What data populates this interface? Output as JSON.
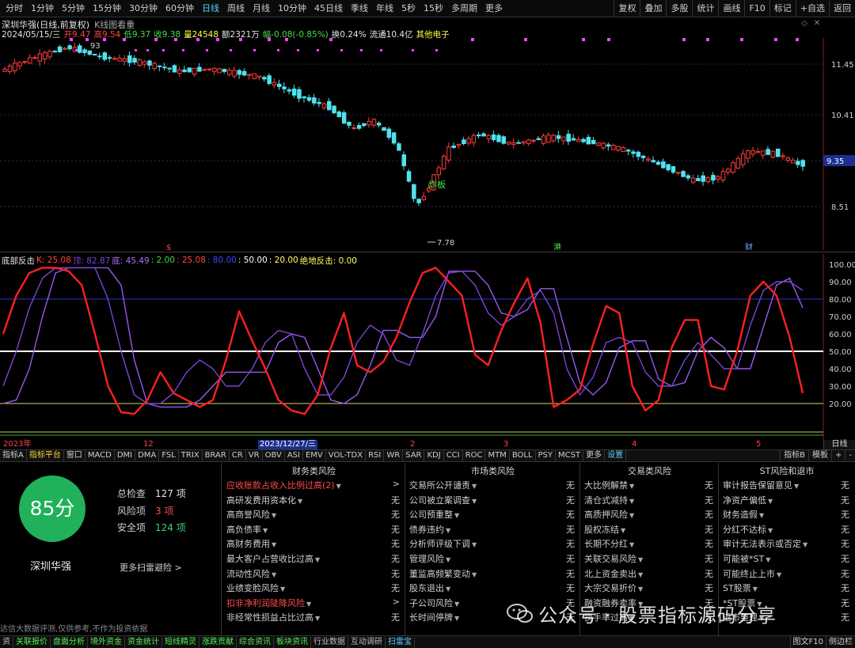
{
  "toolbar": {
    "periods": [
      "分时",
      "1分钟",
      "5分钟",
      "15分钟",
      "30分钟",
      "60分钟",
      "日线",
      "周线",
      "月线",
      "10分钟",
      "45日线",
      "季线",
      "年线",
      "5秒",
      "15秒",
      "多周期",
      "更多"
    ],
    "active_period": "日线",
    "tools": [
      "复权",
      "叠加",
      "多股",
      "统计",
      "画线",
      "F10",
      "标记",
      "+自选",
      "返回"
    ]
  },
  "stock_info": {
    "title": "深圳华强(日线,前复权)",
    "view_label": "K线图看重",
    "date": "2024/05/15/三",
    "open": "开9.47",
    "high": "高9.54",
    "low": "低9.37",
    "close": "收9.38",
    "volume": "量24548",
    "amount": "额2321万",
    "change": "幅-0.08(-0.85%)",
    "turnover": "换0.24%",
    "float_cap": "流通10.4亿",
    "sector": "其他电子"
  },
  "kline_chart": {
    "price_ticks": [
      "11.45",
      "10.41",
      "9.35",
      "8.51"
    ],
    "current_price": "9.35",
    "high_label": "93",
    "low_label": "7.78",
    "signal_label": "炸板",
    "markers": [
      "$",
      "港",
      "财"
    ]
  },
  "oscillator": {
    "header": {
      "name": "底部反击",
      "k": "K: 25.08",
      "d": "顶: 82.87",
      "j": "底: 45.49",
      "v1": ": 2.00",
      "v2": ": 25.08",
      "v3": ": 80.00",
      "v4": ": 50.00",
      "v5": ": 20.00",
      "v6": "绝地反击: 0.00"
    },
    "y_ticks": [
      "100.00",
      "90.00",
      "80.00",
      "70.00",
      "60.00",
      "50.00",
      "40.00",
      "30.00",
      "20.00"
    ]
  },
  "chart_data": [
    {
      "type": "line",
      "title": "",
      "series": [
        {
          "values": [
            60,
            82,
            95,
            98,
            98,
            96,
            88,
            60,
            30,
            15,
            14,
            22,
            38,
            26,
            22,
            18,
            22,
            45,
            73,
            56,
            40,
            22,
            16,
            14,
            25,
            52,
            72,
            42,
            38,
            44,
            58,
            78,
            95,
            98,
            90,
            82,
            48,
            42,
            62,
            78,
            92,
            66,
            18,
            22,
            28,
            54,
            76,
            72,
            30,
            16,
            22,
            52,
            68,
            68,
            30,
            28,
            50,
            82,
            90,
            82,
            58,
            26
          ]
        },
        {
          "values": [
            30,
            50,
            75,
            92,
            98,
            98,
            98,
            98,
            80,
            50,
            25,
            20,
            20,
            26,
            38,
            45,
            40,
            30,
            30,
            40,
            55,
            62,
            60,
            40,
            25,
            25,
            35,
            55,
            65,
            60,
            45,
            42,
            60,
            82,
            95,
            96,
            88,
            72,
            65,
            70,
            80,
            85,
            72,
            40,
            25,
            35,
            55,
            58,
            55,
            38,
            30,
            30,
            45,
            55,
            48,
            40,
            40,
            65,
            85,
            90,
            90,
            85
          ]
        },
        {
          "values": [
            20,
            22,
            40,
            70,
            95,
            98,
            98,
            98,
            98,
            88,
            45,
            20,
            18,
            18,
            18,
            22,
            30,
            38,
            38,
            38,
            38,
            55,
            60,
            58,
            40,
            22,
            20,
            25,
            42,
            62,
            62,
            58,
            58,
            70,
            96,
            96,
            96,
            88,
            72,
            70,
            74,
            86,
            86,
            58,
            32,
            25,
            32,
            52,
            56,
            56,
            34,
            30,
            32,
            50,
            58,
            52,
            40,
            40,
            64,
            88,
            92,
            75
          ]
        }
      ],
      "y_ticks": [
        "100.00",
        "90.00",
        "80.00",
        "70.00",
        "60.00",
        "50.00",
        "40.00",
        "30.00",
        "20.00"
      ],
      "ylim": [
        10,
        100
      ],
      "reference_lines": [
        80,
        50,
        20
      ]
    }
  ],
  "date_axis": {
    "labels": [
      "2023年",
      "12",
      "2023/12/27/三",
      "2",
      "3",
      "4",
      "5"
    ],
    "right_button": "日线"
  },
  "indicators": {
    "tabs": [
      "指标A",
      "指标平台",
      "窗口",
      "MACD",
      "DMI",
      "DMA",
      "FSL",
      "TRIX",
      "BRAR",
      "CR",
      "VR",
      "OBV",
      "ASI",
      "EMV",
      "VOL-TDX",
      "RSI",
      "WR",
      "SAR",
      "KDJ",
      "CCI",
      "ROC",
      "MTM",
      "BOLL",
      "PSY",
      "MCST",
      "更多",
      "设置"
    ],
    "active": "指标平台",
    "right": [
      "指标B",
      "模板",
      "+",
      "-"
    ]
  },
  "scan": {
    "score": "85分",
    "total_label": "总检查",
    "total_value": "127 项",
    "risk_label": "风险项",
    "risk_value": "3 项",
    "safe_label": "安全项",
    "safe_value": "124 项",
    "stock_name": "深圳华强",
    "more_link": "更多扫雷避险 >",
    "disclaimer": "达信大数据评测,仅供参考,不作为投资依据",
    "columns": [
      {
        "title": "财务类风险",
        "rows": [
          {
            "label": "应收账款占收入比例过高(2)",
            "value": ">",
            "warn": true
          },
          {
            "label": "高研发费用资本化",
            "value": "无",
            "warn": false
          },
          {
            "label": "高商誉风险",
            "value": "无",
            "warn": false
          },
          {
            "label": "高负债率",
            "value": "无",
            "warn": false
          },
          {
            "label": "高财务费用",
            "value": "无",
            "warn": false
          },
          {
            "label": "最大客户占营收比过高",
            "value": "无",
            "warn": false
          },
          {
            "label": "流动性风险",
            "value": "无",
            "warn": false
          },
          {
            "label": "业绩变脸风险",
            "value": "无",
            "warn": false
          },
          {
            "label": "扣非净利润陡降风险",
            "value": ">",
            "warn": true
          },
          {
            "label": "非经常性损益占比过高",
            "value": "无",
            "warn": false
          }
        ]
      },
      {
        "title": "市场类风险",
        "rows": [
          {
            "label": "交易所公开谴责",
            "value": "无",
            "warn": false
          },
          {
            "label": "公司被立案调查",
            "value": "无",
            "warn": false
          },
          {
            "label": "公司预重整",
            "value": "无",
            "warn": false
          },
          {
            "label": "债券违约",
            "value": "无",
            "warn": false
          },
          {
            "label": "分析师评级下调",
            "value": "无",
            "warn": false
          },
          {
            "label": "管理风险",
            "value": "无",
            "warn": false
          },
          {
            "label": "董监高频繁变动",
            "value": "无",
            "warn": false
          },
          {
            "label": "股东退出",
            "value": "无",
            "warn": false
          },
          {
            "label": "子公司风险",
            "value": "无",
            "warn": false
          },
          {
            "label": "长时间停牌",
            "value": "无",
            "warn": false
          }
        ]
      },
      {
        "title": "交易类风险",
        "rows": [
          {
            "label": "大比例解禁",
            "value": "无",
            "warn": false
          },
          {
            "label": "清仓式减持",
            "value": "无",
            "warn": false
          },
          {
            "label": "高质押风险",
            "value": "无",
            "warn": false
          },
          {
            "label": "股权冻结",
            "value": "无",
            "warn": false
          },
          {
            "label": "长期不分红",
            "value": "无",
            "warn": false
          },
          {
            "label": "关联交易风险",
            "value": "无",
            "warn": false
          },
          {
            "label": "北上资金卖出",
            "value": "无",
            "warn": false
          },
          {
            "label": "大宗交易折价",
            "value": "无",
            "warn": false
          },
          {
            "label": "融资融券卖率",
            "value": "无",
            "warn": false
          },
          {
            "label": "换手率过高",
            "value": "无",
            "warn": false
          }
        ]
      },
      {
        "title": "ST风险和退市",
        "rows": [
          {
            "label": "审计报告保留意见",
            "value": "无",
            "warn": false
          },
          {
            "label": "净资产偏低",
            "value": "无",
            "warn": false
          },
          {
            "label": "财务造假",
            "value": "无",
            "warn": false
          },
          {
            "label": "分红不达标",
            "value": "无",
            "warn": false
          },
          {
            "label": "审计无法表示或否定",
            "value": "无",
            "warn": false
          },
          {
            "label": "可能被*ST",
            "value": "无",
            "warn": false
          },
          {
            "label": "可能终止上市",
            "value": "无",
            "warn": false
          },
          {
            "label": "ST股票",
            "value": "无",
            "warn": false
          },
          {
            "label": "*ST股票",
            "value": "无",
            "warn": false
          },
          {
            "label": "退市整理",
            "value": "无",
            "warn": false
          }
        ]
      }
    ]
  },
  "watermark": "公众号 · 股票指标源码分享",
  "function_bar": {
    "items": [
      "资",
      "关联报价",
      "盘面分析",
      "境外资金",
      "资金统计",
      "短线精灵",
      "涨跌贡献",
      "综合资讯",
      "板块资讯",
      "行业数据",
      "互动调研",
      "扫雷宝"
    ],
    "right": [
      "图文F10",
      "侧边栏"
    ]
  },
  "colors": {
    "bull": "#ff3b3b",
    "bear": "#4fe3ef",
    "osc_k": "#ff2020",
    "osc_d": "#7a44d6",
    "osc_j": "#9a58f0",
    "score_bg": "#20b15a",
    "warn_text": "#ff4b4b"
  }
}
